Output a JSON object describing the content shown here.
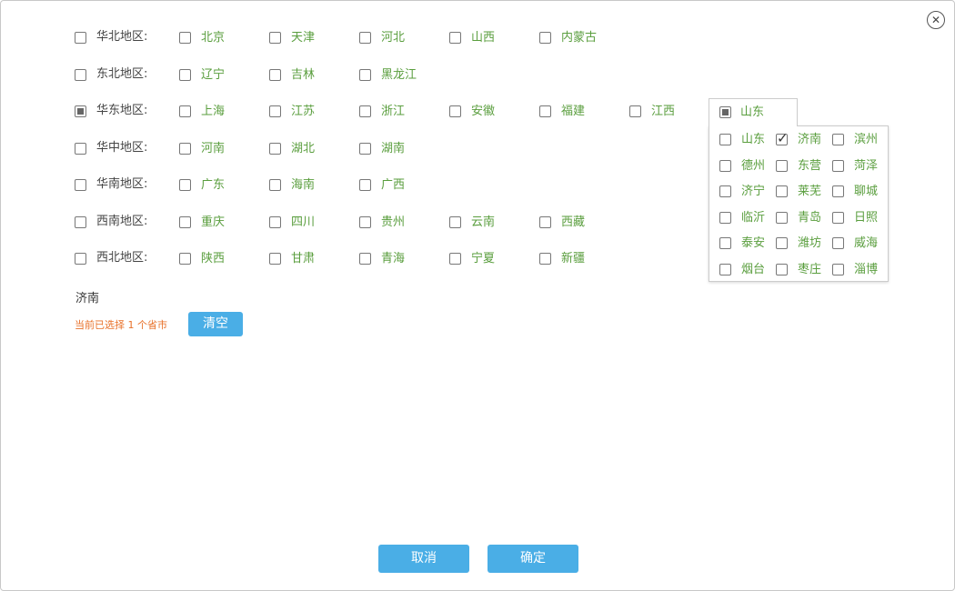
{
  "regions": [
    {
      "label": "华北地区:",
      "state": "unchecked",
      "provinces": [
        "北京",
        "天津",
        "河北",
        "山西",
        "内蒙古"
      ]
    },
    {
      "label": "东北地区:",
      "state": "unchecked",
      "provinces": [
        "辽宁",
        "吉林",
        "黑龙江"
      ]
    },
    {
      "label": "华东地区:",
      "state": "partial",
      "provinces": [
        "上海",
        "江苏",
        "浙江",
        "安徽",
        "福建",
        "江西"
      ]
    },
    {
      "label": "华中地区:",
      "state": "unchecked",
      "provinces": [
        "河南",
        "湖北",
        "湖南"
      ]
    },
    {
      "label": "华南地区:",
      "state": "unchecked",
      "provinces": [
        "广东",
        "海南",
        "广西"
      ]
    },
    {
      "label": "西南地区:",
      "state": "unchecked",
      "provinces": [
        "重庆",
        "四川",
        "贵州",
        "云南",
        "西藏"
      ]
    },
    {
      "label": "西北地区:",
      "state": "unchecked",
      "provinces": [
        "陕西",
        "甘肃",
        "青海",
        "宁夏",
        "新疆"
      ]
    }
  ],
  "popup": {
    "province": "山东",
    "province_state": "partial",
    "cities": [
      {
        "name": "山东",
        "checked": false
      },
      {
        "name": "济南",
        "checked": true
      },
      {
        "name": "滨州",
        "checked": false
      },
      {
        "name": "德州",
        "checked": false
      },
      {
        "name": "东营",
        "checked": false
      },
      {
        "name": "菏泽",
        "checked": false
      },
      {
        "name": "济宁",
        "checked": false
      },
      {
        "name": "莱芜",
        "checked": false
      },
      {
        "name": "聊城",
        "checked": false
      },
      {
        "name": "临沂",
        "checked": false
      },
      {
        "name": "青岛",
        "checked": false
      },
      {
        "name": "日照",
        "checked": false
      },
      {
        "name": "泰安",
        "checked": false
      },
      {
        "name": "潍坊",
        "checked": false
      },
      {
        "name": "威海",
        "checked": false
      },
      {
        "name": "烟台",
        "checked": false
      },
      {
        "name": "枣庄",
        "checked": false
      },
      {
        "name": "淄博",
        "checked": false
      }
    ]
  },
  "selection": {
    "selected_text": "济南",
    "count_text": "当前已选择 1 个省市",
    "clear_label": "清空"
  },
  "footer": {
    "cancel_label": "取消",
    "confirm_label": "确定"
  },
  "colors": {
    "accent": "#4aaee6",
    "province_text": "#5a9e3e",
    "count_text": "#e8712a"
  },
  "icons": {
    "close": "close-icon"
  }
}
